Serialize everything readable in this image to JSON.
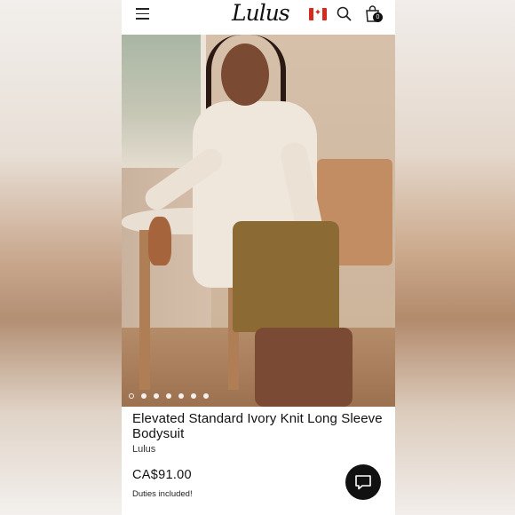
{
  "header": {
    "logo_text": "Lulus",
    "bag_count": "0",
    "flag_icon": "canada-flag-icon",
    "colors": {
      "background": "#ffffff",
      "icon": "#222222"
    }
  },
  "gallery": {
    "image_alt": "Model wearing Elevated Standard Ivory Knit Long Sleeve Bodysuit",
    "slide_count": 7,
    "active_slide": 1
  },
  "product": {
    "title": "Elevated Standard Ivory Knit Long Sleeve Bodysuit",
    "brand": "Lulus",
    "price": "CA$91.00",
    "duties_note": "Duties included!"
  },
  "chat": {
    "icon": "chat-bubble-icon",
    "color": "#111111"
  }
}
